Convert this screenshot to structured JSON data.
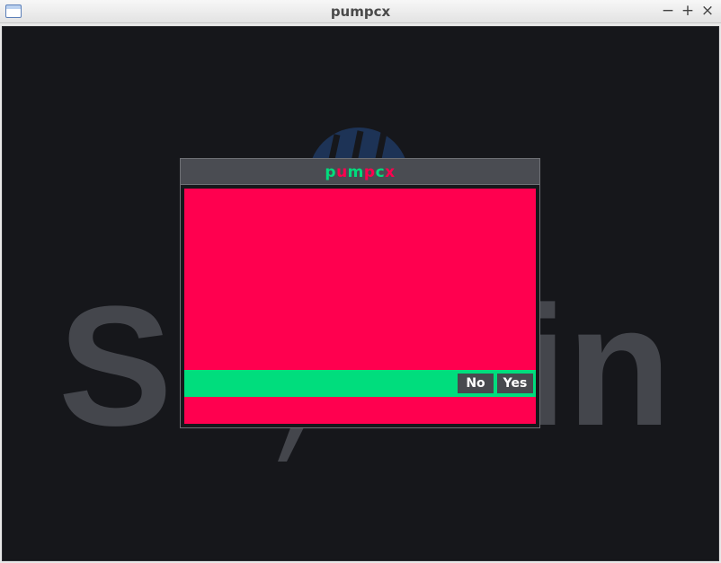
{
  "window": {
    "title": "pumpcx",
    "controls": {
      "minimize": "−",
      "maximize": "+",
      "close": "×"
    }
  },
  "background": {
    "logo_text": "SI",
    "logo_text_tail": "in",
    "logo_color": "#44464c"
  },
  "dialog": {
    "title_chars": [
      "p",
      "u",
      "m",
      "p",
      "c",
      "x"
    ],
    "title_colors": [
      "#00dd7d",
      "#ff004f",
      "#00dd7d",
      "#ff004f",
      "#00dd7d",
      "#ff004f"
    ],
    "buttons": {
      "no": "No",
      "yes": "Yes"
    }
  },
  "colors": {
    "body": "#ff004f",
    "bar": "#00dd7d",
    "canvas": "#16171b",
    "header": "#4a4c52"
  }
}
